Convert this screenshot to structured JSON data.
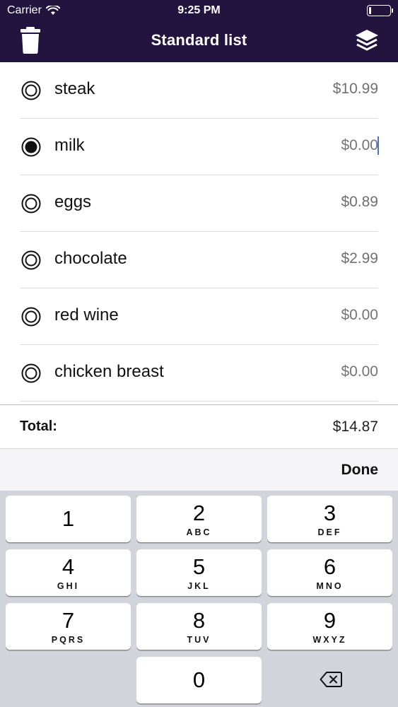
{
  "status": {
    "carrier": "Carrier",
    "time": "9:25 PM",
    "battery_level": 0.12
  },
  "nav": {
    "title": "Standard list",
    "left_icon": "trash-icon",
    "right_icon": "layers-icon"
  },
  "items": [
    {
      "name": "steak",
      "price": "$10.99",
      "selected": false,
      "empty": false
    },
    {
      "name": "milk",
      "price": "$0.00",
      "selected": true,
      "empty": true
    },
    {
      "name": "eggs",
      "price": "$0.89",
      "selected": false,
      "empty": false
    },
    {
      "name": "chocolate",
      "price": "$2.99",
      "selected": false,
      "empty": false
    },
    {
      "name": "red wine",
      "price": "$0.00",
      "selected": false,
      "empty": true
    },
    {
      "name": "chicken breast",
      "price": "$0.00",
      "selected": false,
      "empty": true
    }
  ],
  "total": {
    "label": "Total:",
    "value": "$14.87"
  },
  "accessory": {
    "done_label": "Done"
  },
  "keypad": {
    "keys": [
      {
        "digit": "1",
        "letters": ""
      },
      {
        "digit": "2",
        "letters": "ABC"
      },
      {
        "digit": "3",
        "letters": "DEF"
      },
      {
        "digit": "4",
        "letters": "GHI"
      },
      {
        "digit": "5",
        "letters": "JKL"
      },
      {
        "digit": "6",
        "letters": "MNO"
      },
      {
        "digit": "7",
        "letters": "PQRS"
      },
      {
        "digit": "8",
        "letters": "TUV"
      },
      {
        "digit": "9",
        "letters": "WXYZ"
      },
      {
        "digit": "0",
        "letters": ""
      }
    ],
    "backspace_icon": "backspace-icon"
  },
  "colors": {
    "header_bg": "#22133f",
    "caret": "#4a6ee0",
    "keypad_bg": "#d1d4da"
  }
}
